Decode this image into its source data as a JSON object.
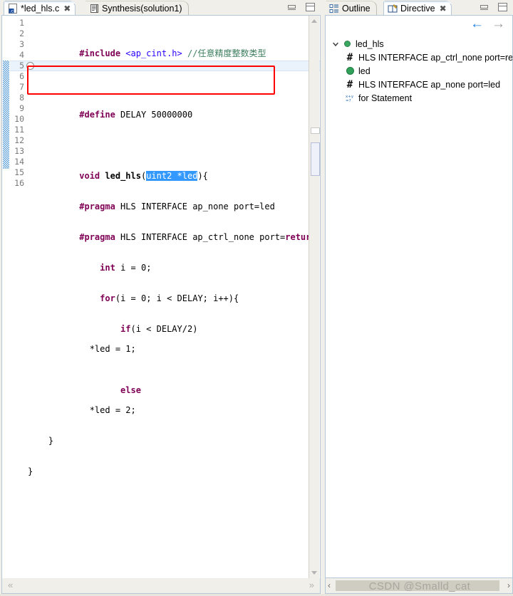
{
  "editor": {
    "tabs": [
      {
        "label": "*led_hls.c",
        "icon": "c-file-icon",
        "active": true,
        "closeable": true
      },
      {
        "label": "Synthesis(solution1)",
        "icon": "report-icon",
        "active": false,
        "closeable": false
      }
    ],
    "window_controls": {
      "minimize": "minimize-icon",
      "maximize": "maximize-icon"
    },
    "line_numbers": [
      "1",
      "2",
      "3",
      "4",
      "5",
      "6",
      "7",
      "8",
      "9",
      "10",
      "11",
      "12",
      "13",
      "14",
      "15",
      "16"
    ],
    "code_lines": [
      "#include <ap_cint.h> //任意精度整数类型",
      "",
      "#define DELAY 50000000",
      "",
      "void led_hls(uint2 *led){",
      "#pragma HLS INTERFACE ap_none port=led",
      "#pragma HLS INTERFACE ap_ctrl_none port=return",
      "    int i = 0;",
      "    for(i = 0; i < DELAY; i++){",
      "        if(i < DELAY/2)",
      "            *led = 1;",
      "        else",
      "            *led = 2;",
      "    }",
      "}",
      ""
    ],
    "selection_text": "uint2 *led",
    "comment_text": "//任意精度整数类型",
    "highlight_color": "#3399ff",
    "annotation_box_color": "#ff0000",
    "scroll_left_arrow": "«",
    "scroll_right_arrow": "»"
  },
  "right_panel": {
    "tabs": [
      {
        "label": "Outline",
        "icon": "outline-icon",
        "active": false,
        "closeable": false
      },
      {
        "label": "Directive",
        "icon": "directive-icon",
        "active": true,
        "closeable": true
      }
    ],
    "window_controls": {
      "minimize": "minimize-icon",
      "maximize": "maximize-icon"
    },
    "toolbar": {
      "back_label": "←",
      "forward_label": "→",
      "back_color": "#1e7fe0",
      "forward_color": "#9b9b9b"
    },
    "tree": [
      {
        "label": "led_hls",
        "icon": "green-circle-icon",
        "indent": 0,
        "expanded": true
      },
      {
        "label": "HLS INTERFACE ap_ctrl_none port=return",
        "icon": "pragma-hash-icon",
        "indent": 1
      },
      {
        "label": "led",
        "icon": "green-filled-circle-icon",
        "indent": 1
      },
      {
        "label": "HLS INTERFACE ap_none port=led",
        "icon": "pragma-hash-icon",
        "indent": 1
      },
      {
        "label": "for Statement",
        "icon": "formula-icon",
        "indent": 1
      }
    ],
    "scroll_left_arrow": "‹",
    "scroll_right_arrow": "›",
    "watermark": "CSDN @Smalld_cat"
  }
}
